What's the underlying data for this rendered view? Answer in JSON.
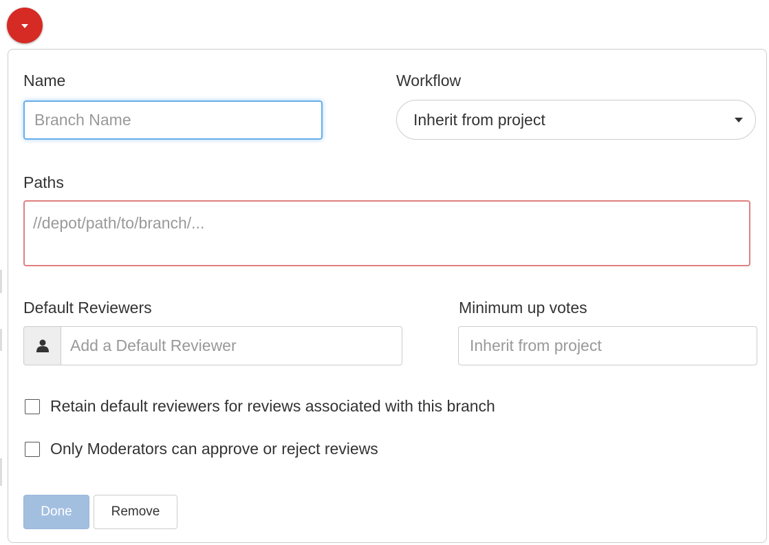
{
  "toggle": {
    "icon": "caret-down-icon",
    "color": "#d62a24"
  },
  "form": {
    "name_label": "Name",
    "name_placeholder": "Branch Name",
    "workflow_label": "Workflow",
    "workflow_value": "Inherit from project",
    "paths_label": "Paths",
    "paths_placeholder": "//depot/path/to/branch/...",
    "reviewers_label": "Default Reviewers",
    "reviewers_placeholder": "Add a Default Reviewer",
    "reviewers_icon": "user-icon",
    "upvotes_label": "Minimum up votes",
    "upvotes_placeholder": "Inherit from project",
    "retain_label": "Retain default reviewers for reviews associated with this branch",
    "retain_checked": false,
    "moderators_label": "Only Moderators can approve or reject reviews",
    "moderators_checked": false
  },
  "buttons": {
    "done": "Done",
    "remove": "Remove"
  },
  "colors": {
    "focus_border": "#66afe9",
    "error_border": "#e07f7f",
    "done_disabled": "#a3bfe0"
  }
}
